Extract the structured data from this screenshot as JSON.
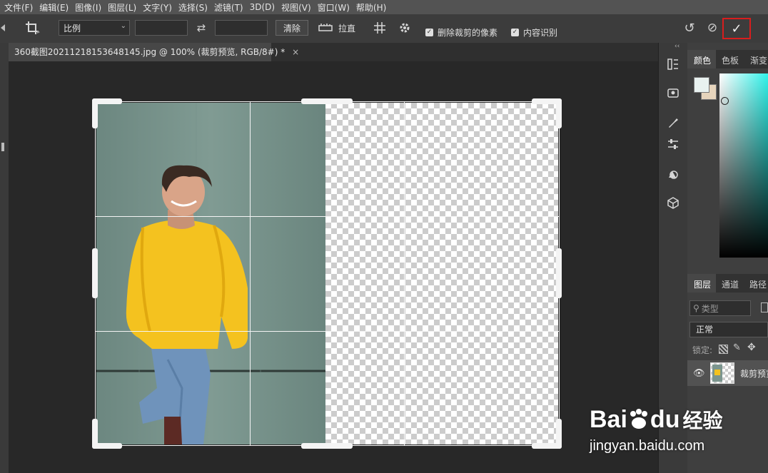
{
  "menu": [
    "文件(F)",
    "编辑(E)",
    "图像(I)",
    "图层(L)",
    "文字(Y)",
    "选择(S)",
    "滤镜(T)",
    "3D(D)",
    "视图(V)",
    "窗口(W)",
    "帮助(H)"
  ],
  "options_bar": {
    "ratio_select": "比例",
    "swap_icon": "⇄",
    "clear_button": "清除",
    "straighten_label": "拉直",
    "delete_cropped_label": "删除裁剪的像素",
    "content_aware_label": "内容识别",
    "reset_icon": "↺",
    "cancel_icon": "⊘",
    "commit_icon": "✓"
  },
  "document_tab": {
    "title": "360截图20211218153648145.jpg @ 100% (裁剪预览, RGB/8#) *",
    "close": "×"
  },
  "right_panel": {
    "collapse": "‹‹",
    "color_tabs": [
      "颜色",
      "色板",
      "渐变"
    ],
    "layers_tabs": [
      "图层",
      "通道",
      "路径"
    ],
    "search_placeholder": "类型",
    "blend_mode": "正常",
    "lock_label": "锁定:",
    "layer_name": "裁剪预览"
  },
  "colors": {
    "accent_red": "#d81e1e",
    "sweater": "#f4c21f",
    "wall": "#7b958e"
  },
  "watermark": {
    "brand": "Bai",
    "brand_tail": "du",
    "product": "经验",
    "url": "jingyan.baidu.com"
  }
}
